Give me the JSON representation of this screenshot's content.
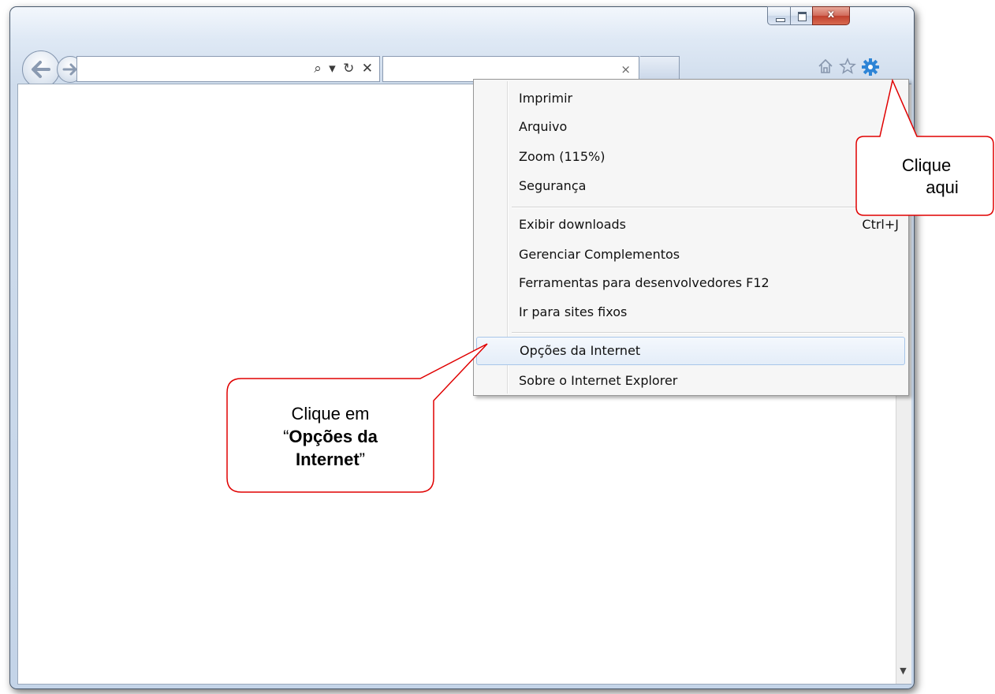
{
  "window": {
    "controls": {
      "minimize_icon": "minimize-icon",
      "maximize_icon": "maximize-icon",
      "close_symbol": "x"
    }
  },
  "toolbar": {
    "address_value": "",
    "address_tools": "⌕ ▾ ↻ ✕",
    "search_value": "",
    "search_clear": "×",
    "icons": [
      "home-icon",
      "favorites-star-icon",
      "gear-icon"
    ]
  },
  "menu": {
    "items_group1": [
      {
        "label": "Imprimir"
      },
      {
        "label": "Arquivo"
      },
      {
        "label": "Zoom (115%)"
      },
      {
        "label": "Segurança"
      }
    ],
    "items_group2": [
      {
        "label": "Exibir downloads",
        "shortcut": "Ctrl+J"
      },
      {
        "label": "Gerenciar Complementos"
      },
      {
        "label": "Ferramentas para desenvolvedores F12"
      },
      {
        "label": "Ir para sites fixos"
      }
    ],
    "items_group3": [
      {
        "label": "Opções da Internet",
        "highlighted": true
      },
      {
        "label": "Sobre o Internet Explorer"
      }
    ]
  },
  "callouts": {
    "gear": {
      "line1": "Clique",
      "line2": "aqui"
    },
    "options": {
      "line1": "Clique em",
      "open_quote": "“",
      "bold": "Opções da Internet",
      "close_quote": "”"
    }
  },
  "colors": {
    "callout_border": "#e00000",
    "gear": "#2d84d6",
    "highlight_border": "#a8c6e9"
  }
}
